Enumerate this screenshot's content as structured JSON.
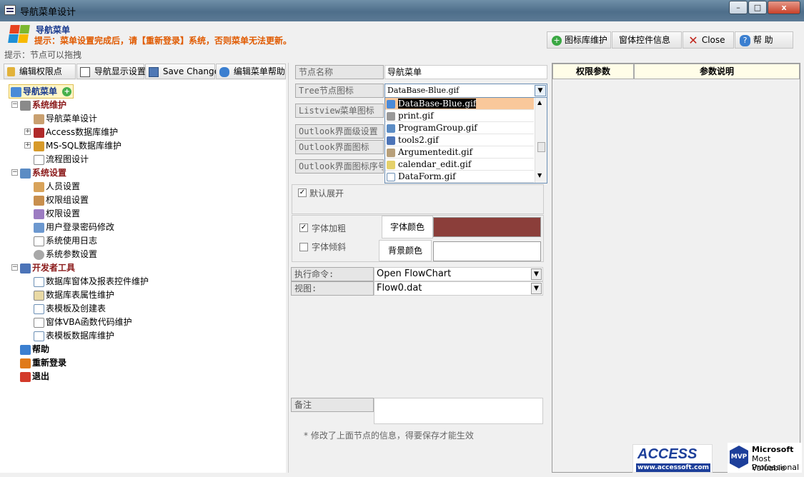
{
  "window": {
    "title": "导航菜单设计",
    "min_label": "–",
    "max_label": "□",
    "close_label": "x"
  },
  "header": {
    "app_name": "导航菜单",
    "hint": "提示：菜单设置完成后，请【重新登录】系统，否则菜单无法更新。",
    "drag_hint": "提示：节点可以拖拽"
  },
  "toolbar": {
    "icon_lib_label": "图标库维护",
    "form_controls_label": "窗体控件信息",
    "close_label": "Close",
    "help_label": "帮  助"
  },
  "left_tabs": {
    "perm_label": "编辑权限点",
    "nav_display_label": "导航显示设置",
    "save_label": "Save Changed",
    "menu_help_label": "编辑菜单帮助"
  },
  "tree": {
    "root": "导航菜单",
    "sys_maint": "系统维护",
    "nav_design": "导航菜单设计",
    "access_db": "Access数据库维护",
    "mssql_db": "MS-SQL数据库维护",
    "flowchart": "流程图设计",
    "sys_settings": "系统设置",
    "personnel": "人员设置",
    "perm_group": "权限组设置",
    "perm": "权限设置",
    "pwd_change": "用户登录密码修改",
    "sys_log": "系统使用日志",
    "sys_params": "系统参数设置",
    "dev_tools": "开发者工具",
    "form_report": "数据库窗体及报表控件维护",
    "table_attr": "数据库表属性维护",
    "template_table": "表模板及创建表",
    "vba_code": "窗体VBA函数代码维护",
    "template_db": "表模板数据库维护",
    "help": "帮助",
    "relogin": "重新登录",
    "exit": "退出"
  },
  "form": {
    "node_name_label": "节点名称",
    "node_name_value": "导航菜单",
    "tree_icon_label": "Tree节点图标",
    "tree_icon_value": "DataBase-Blue.gif",
    "listview_icon_label": "Listview菜单图标",
    "outlook_level_label": "Outlook界面级设置",
    "outlook_icon_label": "Outlook界面图标",
    "outlook_icon_order_label": "Outlook界面图标序号",
    "icon_options": [
      "DataBase-Blue.gif",
      "print.gif",
      "ProgramGroup.gif",
      "tools2.gif",
      "Argumentedit.gif",
      "calendar_edit.gif",
      "DataForm.gif"
    ],
    "default_expand_label": "默认展开",
    "bold_label": "字体加粗",
    "italic_label": "字体倾斜",
    "font_color_label": "字体颜色",
    "bg_color_label": "背景颜色",
    "font_color": "#8b3e3a",
    "bg_color": "#ffffff",
    "exec_cmd_label": "执行命令:",
    "exec_cmd_value": "Open FlowChart",
    "view_label": "视图:",
    "view_value": "Flow0.dat",
    "remark_label": "备注",
    "footnote": "* 修改了上面节点的信息，得要保存才能生效"
  },
  "right_panel": {
    "col_perm": "权限参数",
    "col_desc": "参数说明"
  },
  "logos": {
    "access_name": "ACCESS",
    "access_url": "www.accessoft.com",
    "mvp_badge": "MVP",
    "mvp_line1": "Microsoft",
    "mvp_line2": "Most Valuable",
    "mvp_line3": "Professional"
  },
  "colors": {
    "hint_orange": "#e05a00",
    "title_blue": "#1a3b8f",
    "selected_row": "#f9c89b",
    "tree_red": "#8b1a1a"
  }
}
